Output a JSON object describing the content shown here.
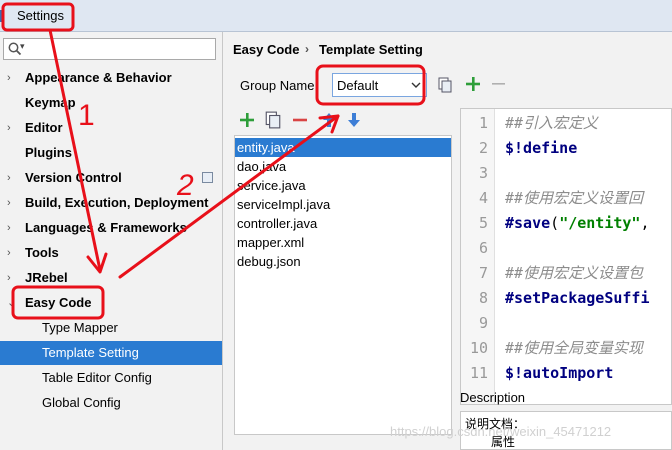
{
  "window": {
    "title": "Settings"
  },
  "search": {
    "placeholder": ""
  },
  "sidebar": {
    "items": [
      {
        "label": "Appearance & Behavior",
        "arrow": "›"
      },
      {
        "label": "Keymap",
        "arrow": ""
      },
      {
        "label": "Editor",
        "arrow": "›"
      },
      {
        "label": "Plugins",
        "arrow": ""
      },
      {
        "label": "Version Control",
        "arrow": "›"
      },
      {
        "label": "Build, Execution, Deployment",
        "arrow": "›"
      },
      {
        "label": "Languages & Frameworks",
        "arrow": "›"
      },
      {
        "label": "Tools",
        "arrow": "›"
      },
      {
        "label": "JRebel",
        "arrow": "›"
      },
      {
        "label": "Easy Code",
        "arrow": "⌄"
      }
    ],
    "children": [
      {
        "label": "Type Mapper"
      },
      {
        "label": "Template Setting"
      },
      {
        "label": "Table Editor Config"
      },
      {
        "label": "Global Config"
      }
    ]
  },
  "breadcrumb": {
    "parent": "Easy Code",
    "separator": "›",
    "current": "Template Setting"
  },
  "group": {
    "label": "Group Name:",
    "value": "Default"
  },
  "files": [
    "entity.java",
    "dao.java",
    "service.java",
    "serviceImpl.java",
    "controller.java",
    "mapper.xml",
    "debug.json"
  ],
  "editor": {
    "lines": [
      {
        "n": "1",
        "parts": [
          {
            "t": "##引入宏定义",
            "c": "cm"
          }
        ]
      },
      {
        "n": "2",
        "parts": [
          {
            "t": "$!define",
            "c": "kw"
          }
        ]
      },
      {
        "n": "3",
        "parts": []
      },
      {
        "n": "4",
        "parts": [
          {
            "t": "##使用宏定义设置回",
            "c": "cm"
          }
        ]
      },
      {
        "n": "5",
        "parts": [
          {
            "t": "#save",
            "c": "kw"
          },
          {
            "t": "(",
            "c": ""
          },
          {
            "t": "\"/entity\"",
            "c": "str"
          },
          {
            "t": ",",
            "c": ""
          }
        ]
      },
      {
        "n": "6",
        "parts": []
      },
      {
        "n": "7",
        "parts": [
          {
            "t": "##使用宏定义设置包",
            "c": "cm"
          }
        ]
      },
      {
        "n": "8",
        "parts": [
          {
            "t": "#setPackageSuffi",
            "c": "kw"
          }
        ]
      },
      {
        "n": "9",
        "parts": []
      },
      {
        "n": "10",
        "parts": [
          {
            "t": "##使用全局变量实现",
            "c": "cm"
          }
        ]
      },
      {
        "n": "11",
        "parts": [
          {
            "t": "$!autoImport",
            "c": "kw"
          }
        ]
      }
    ]
  },
  "description": {
    "label": "Description",
    "line1": "说明文档：",
    "line2": "属性"
  },
  "annotations": {
    "num1": "1",
    "num2": "2"
  },
  "watermark": "https://blog.csdn.net/weixin_45471212",
  "colors": {
    "selection": "#2a7bd1",
    "annotation": "#e8101a",
    "add": "#2e9e3a",
    "remove": "#d94444",
    "move": "#3d7ed6"
  }
}
